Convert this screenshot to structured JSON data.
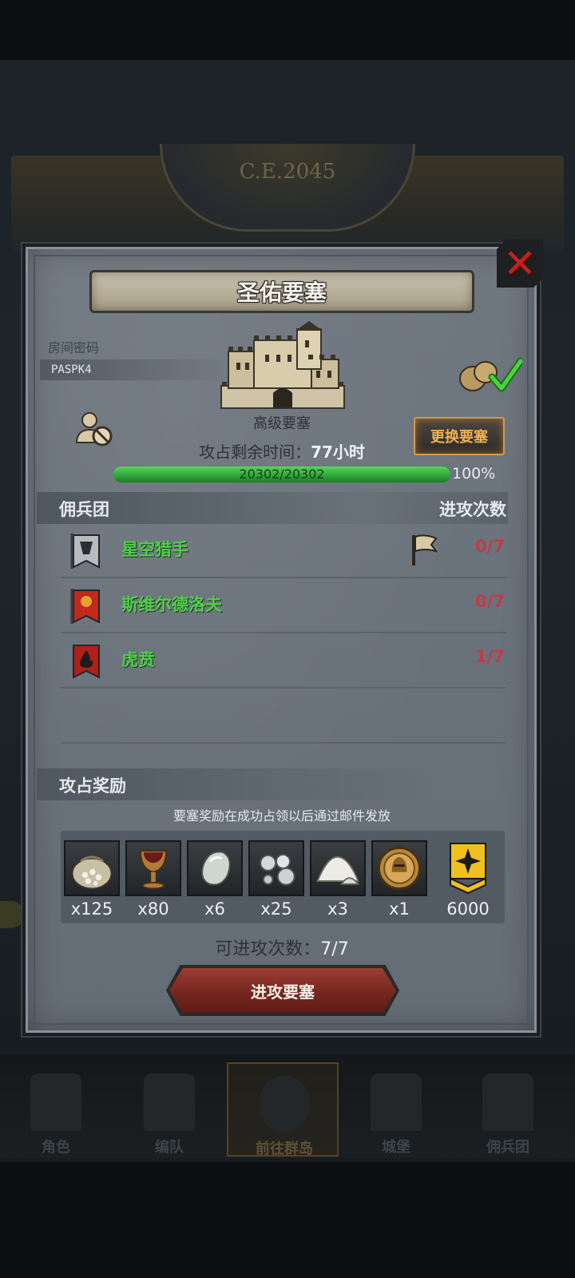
{
  "background": {
    "year": "C.E.2045",
    "nav": [
      {
        "label": "角色",
        "icon": "knight-icon"
      },
      {
        "label": "编队",
        "icon": "formation-icon"
      },
      {
        "label": "前往群岛",
        "icon": "globe-icon",
        "active": true
      },
      {
        "label": "城堡",
        "icon": "castle-icon"
      },
      {
        "label": "佣兵团",
        "icon": "mercenary-icon"
      }
    ]
  },
  "dialog": {
    "title": "圣佑要塞",
    "room_code_label": "房间密码",
    "room_code": "PASPK4",
    "fortress_grade": "高级要塞",
    "change_button": "更换要塞",
    "time_label": "攻占剩余时间：",
    "time_value": "77小时",
    "hp_text": "20302/20302",
    "hp_fraction": 1.0,
    "hp_percent": "100%",
    "mercenary_header": "佣兵团",
    "attack_count_header": "进攻次数",
    "mercenaries": [
      {
        "name": "星空猎手",
        "count": "0/7",
        "banner_color": "#b8bcc0",
        "has_flag": true
      },
      {
        "name": "斯维尔德洛夫",
        "count": "0/7",
        "banner_color": "#c2281c",
        "has_flag": false
      },
      {
        "name": "虎贲",
        "count": "1/7",
        "banner_color": "#b11f1a",
        "has_flag": false
      }
    ],
    "reward_header": "攻占奖励",
    "reward_note": "要塞奖励在成功占领以后通过邮件发放",
    "rewards": [
      {
        "icon": "grain-sack-icon",
        "count": "x125"
      },
      {
        "icon": "goblet-icon",
        "count": "x80"
      },
      {
        "icon": "gem-stone-icon",
        "count": "x6"
      },
      {
        "icon": "silver-orbs-icon",
        "count": "x25"
      },
      {
        "icon": "salt-pile-icon",
        "count": "x3"
      },
      {
        "icon": "helmet-medal-icon",
        "count": "x1"
      },
      {
        "icon": "rank-badge-icon",
        "count": "6000"
      }
    ],
    "attack_remaining_label": "可进攻次数：",
    "attack_remaining_value": "7/7",
    "attack_button": "进攻要塞"
  }
}
